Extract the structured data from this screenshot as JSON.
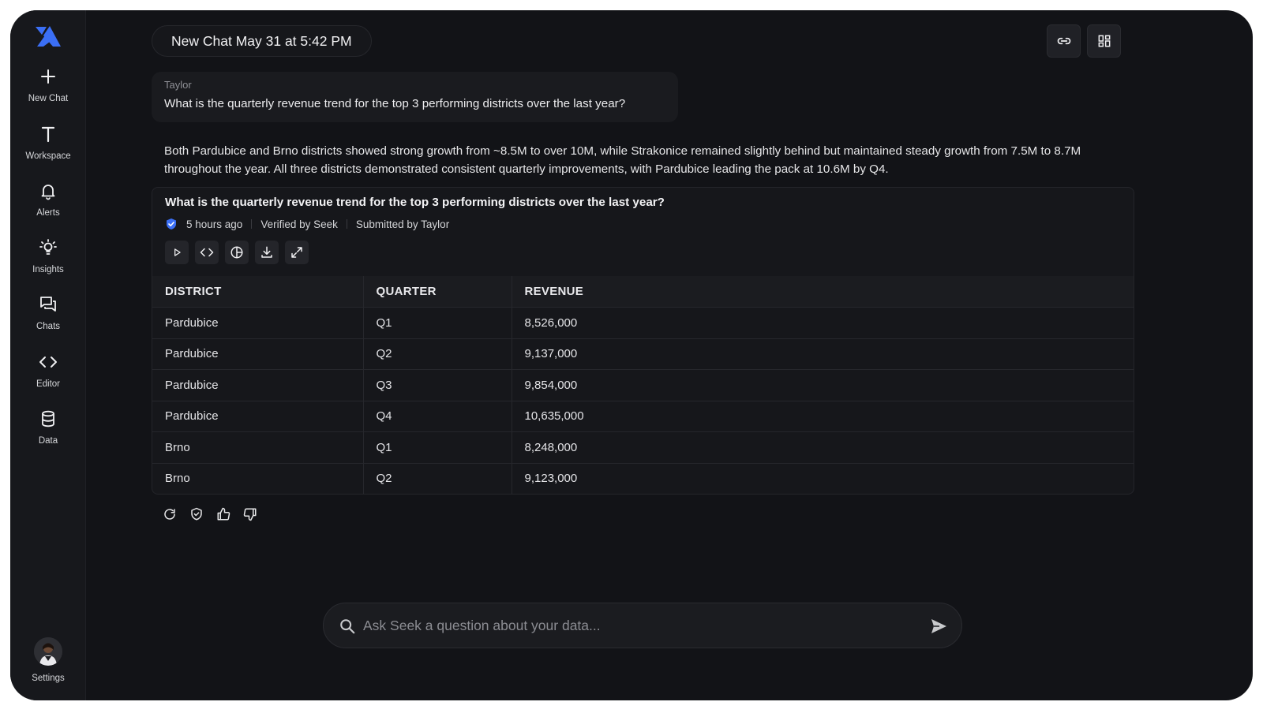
{
  "sidebar": {
    "items": [
      {
        "label": "New Chat",
        "icon": "plus-icon"
      },
      {
        "label": "Workspace",
        "icon": "t-letter-icon"
      },
      {
        "label": "Alerts",
        "icon": "bell-icon"
      },
      {
        "label": "Insights",
        "icon": "lightbulb-icon"
      },
      {
        "label": "Chats",
        "icon": "chat-bubbles-icon"
      },
      {
        "label": "Editor",
        "icon": "code-icon"
      },
      {
        "label": "Data",
        "icon": "database-icon"
      }
    ],
    "settings_label": "Settings"
  },
  "header": {
    "title": "New Chat May 31 at 5:42 PM"
  },
  "user_message": {
    "author": "Taylor",
    "text": "What is the quarterly revenue trend for the top 3 performing districts over the last year?"
  },
  "assistant_answer": "Both Pardubice and Brno districts showed strong growth from ~8.5M to over 10M, while Strakonice remained slightly behind but maintained steady growth from 7.5M to 8.7M throughout the year. All three districts demonstrated consistent quarterly improvements, with Pardubice leading the pack at 10.6M by Q4.",
  "result_card": {
    "title": "What is the quarterly revenue trend for the top 3 performing districts over the last year?",
    "time_ago": "5 hours ago",
    "verified_by": "Verified by Seek",
    "submitted_by": "Submitted by Taylor",
    "columns": [
      "DISTRICT",
      "QUARTER",
      "REVENUE"
    ],
    "rows": [
      [
        "Pardubice",
        "Q1",
        "8,526,000"
      ],
      [
        "Pardubice",
        "Q2",
        "9,137,000"
      ],
      [
        "Pardubice",
        "Q3",
        "9,854,000"
      ],
      [
        "Pardubice",
        "Q4",
        "10,635,000"
      ],
      [
        "Brno",
        "Q1",
        "8,248,000"
      ],
      [
        "Brno",
        "Q2",
        "9,123,000"
      ]
    ]
  },
  "ask_bar": {
    "placeholder": "Ask Seek a question about your data..."
  },
  "colors": {
    "accent": "#3b6ff5",
    "background": "#121317",
    "sidebar": "#17181c"
  }
}
